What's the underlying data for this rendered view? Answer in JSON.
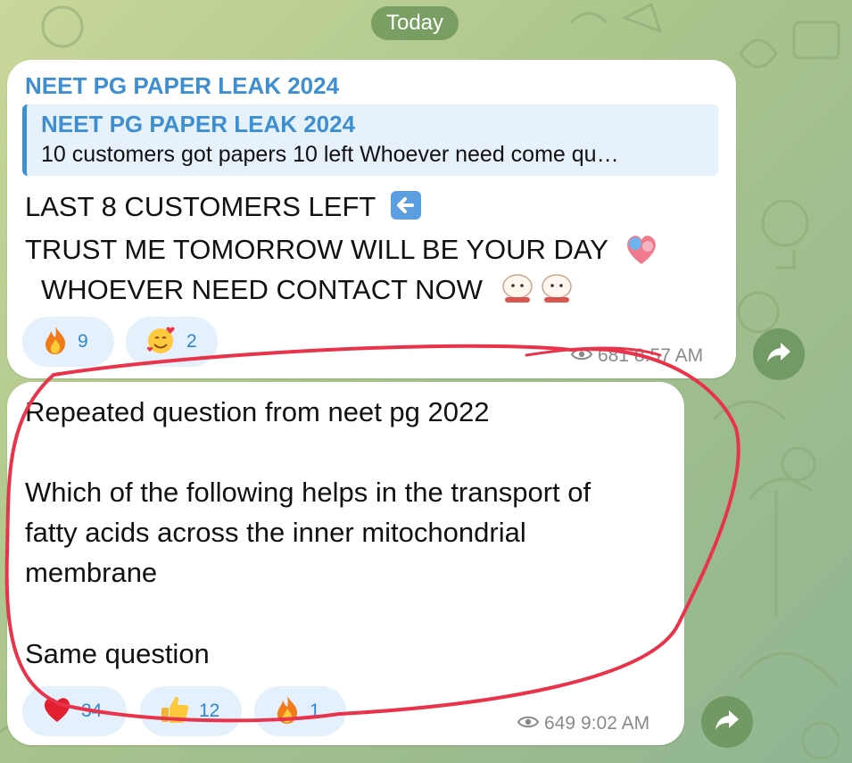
{
  "date_separator": "Today",
  "messages": [
    {
      "sender": "NEET PG PAPER LEAK 2024",
      "quote": {
        "title": "NEET PG PAPER LEAK 2024",
        "text": "10 customers got papers 10 left Whoever need come qu…"
      },
      "lines": [
        "LAST 8 CUSTOMERS LEFT",
        "TRUST ME TOMORROW WILL BE YOUR DAY",
        "WHOEVER NEED CONTACT NOW"
      ],
      "reactions": [
        {
          "emoji": "fire-emoji",
          "count": "9"
        },
        {
          "emoji": "smiling-face-with-hearts-emoji",
          "count": "2"
        }
      ],
      "views": "681",
      "time": "8:57 AM"
    },
    {
      "lines": [
        "Repeated question from neet pg 2022",
        "",
        "Which of the following helps in the transport of",
        "fatty acids across the inner mitochondrial",
        "membrane",
        "",
        "Same question"
      ],
      "reactions": [
        {
          "emoji": "red-heart-emoji",
          "count": "34"
        },
        {
          "emoji": "thumbs-up-emoji",
          "count": "12"
        },
        {
          "emoji": "fire-emoji",
          "count": "1"
        }
      ],
      "views": "649",
      "time": "9:02 AM"
    }
  ],
  "colors": {
    "accent": "#3d8fd1",
    "reaction_bg": "#e4f0fb",
    "annotation": "#e8334a"
  }
}
